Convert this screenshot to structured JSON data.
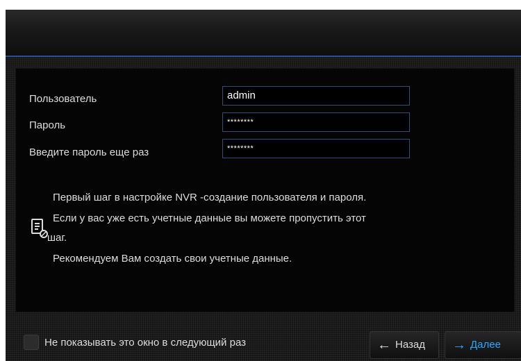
{
  "form": {
    "username_label": "Пользователь",
    "username_value": "admin",
    "password_label": "Пароль",
    "password_value": "********",
    "confirm_label": "Введите пароль еще раз",
    "confirm_value": "********"
  },
  "info": {
    "icon": "document-check-icon",
    "line1": "Первый шаг в настройке NVR -создание пользователя и пароля.",
    "line2": "Если у вас уже есть учетные данные вы можете пропустить этот",
    "line3": "шаг.",
    "line4": "Рекомендуем Вам создать свои учетные данные."
  },
  "footer": {
    "dont_show_label": "Не показывать это окно в следующий раз",
    "dont_show_checked": false,
    "back_label": "Назад",
    "next_label": "Далее"
  },
  "colors": {
    "accent": "#2aa8ff",
    "input_border": "#2f4d7e",
    "background": "#161616"
  }
}
